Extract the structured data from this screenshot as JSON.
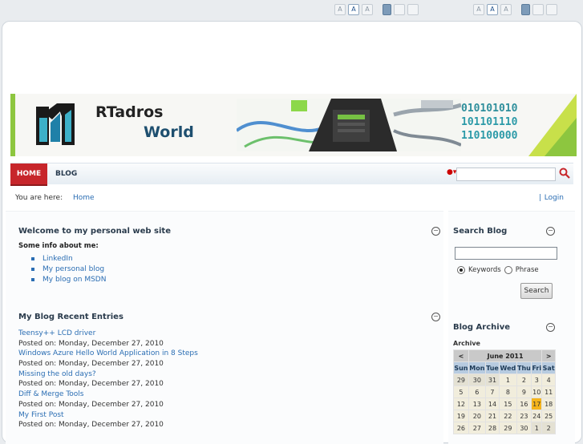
{
  "toolbar": {
    "font_size_buttons": [
      "A",
      "A",
      "A"
    ],
    "selected_font_index": 1
  },
  "banner": {
    "brand_line1": "RTadros",
    "brand_line2": "World",
    "binary_lines": [
      "010101010",
      "101101110",
      "110100000"
    ]
  },
  "nav": {
    "items": [
      {
        "label": "HOME",
        "active": true
      },
      {
        "label": "BLOG",
        "active": false
      }
    ],
    "search_placeholder": ""
  },
  "breadcrumb": {
    "prefix": "You are here:",
    "home": "Home",
    "separator": "|",
    "login": "Login"
  },
  "welcome": {
    "title": "Welcome to my personal web site",
    "subtitle": "Some info about me:",
    "links": [
      "LinkedIn",
      "My personal blog",
      "My blog on MSDN"
    ]
  },
  "recent": {
    "title": "My Blog Recent Entries",
    "entries": [
      {
        "title": "Teensy++ LCD driver",
        "posted": "Posted on: Monday, December 27, 2010"
      },
      {
        "title": "Windows Azure Hello World Application in 8 Steps",
        "posted": "Posted on: Monday, December 27, 2010"
      },
      {
        "title": "Missing the old days?",
        "posted": "Posted on: Monday, December 27, 2010"
      },
      {
        "title": "Diff & Merge Tools",
        "posted": "Posted on: Monday, December 27, 2010"
      },
      {
        "title": "My First Post",
        "posted": "Posted on: Monday, December 27, 2010"
      }
    ]
  },
  "search_blog": {
    "title": "Search Blog",
    "input_value": "",
    "option_keywords": "Keywords",
    "option_phrase": "Phrase",
    "selected": "Keywords",
    "button": "Search"
  },
  "archive": {
    "title": "Blog Archive",
    "label": "Archive",
    "calendar": {
      "prev": "<",
      "next": ">",
      "month": "June 2011",
      "days_of_week": [
        "Sun",
        "Mon",
        "Tue",
        "Wed",
        "Thu",
        "Fri",
        "Sat"
      ],
      "weeks": [
        [
          "29",
          "30",
          "31",
          "1",
          "2",
          "3",
          "4"
        ],
        [
          "5",
          "6",
          "7",
          "8",
          "9",
          "10",
          "11"
        ],
        [
          "12",
          "13",
          "14",
          "15",
          "16",
          "17",
          "18"
        ],
        [
          "19",
          "20",
          "21",
          "22",
          "23",
          "24",
          "25"
        ],
        [
          "26",
          "27",
          "28",
          "29",
          "30",
          "1",
          "2"
        ]
      ],
      "today": "17"
    }
  },
  "colors": {
    "nav_active": "#c7262b",
    "link": "#2a6db3",
    "today_highlight": "#f5b41b",
    "banner_accent": "#8dc63f"
  }
}
